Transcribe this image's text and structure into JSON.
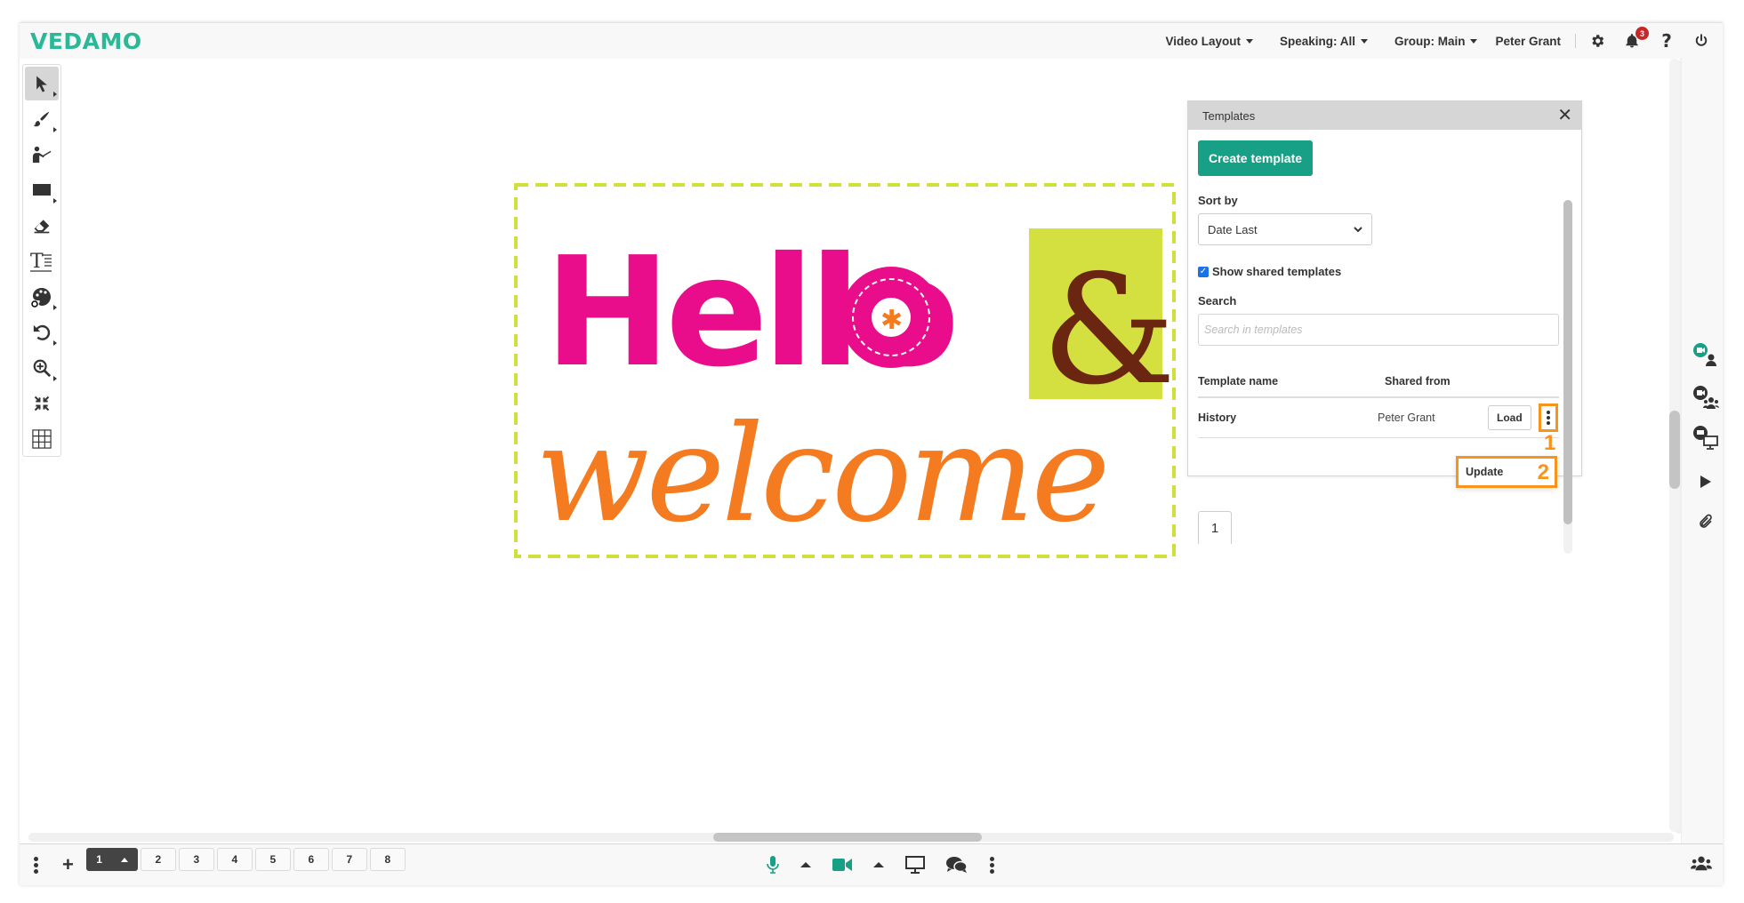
{
  "app": {
    "logo": "VEDAMO",
    "brand_color": "#2bb896",
    "accent_color": "#17a085",
    "annotation_color": "#f7941d"
  },
  "topbar": {
    "menus": [
      {
        "label": "Video Layout",
        "has_caret": true
      },
      {
        "label": "Speaking: All",
        "has_caret": true
      },
      {
        "label": "Group: Main",
        "has_caret": true
      }
    ],
    "user_name": "Peter Grant",
    "icons": [
      "gear-icon",
      "bell-icon",
      "help-icon",
      "power-icon"
    ],
    "notification_count": "3"
  },
  "toolbar": {
    "tools": [
      {
        "name": "select-tool",
        "icon": "cursor-icon",
        "active": true,
        "has_submenu": true
      },
      {
        "name": "brush-tool",
        "icon": "brush-icon",
        "has_submenu": true
      },
      {
        "name": "presenter-tool",
        "icon": "presenter-icon",
        "has_submenu": false
      },
      {
        "name": "shape-tool",
        "icon": "rectangle-icon",
        "has_submenu": true
      },
      {
        "name": "eraser-tool",
        "icon": "eraser-icon",
        "has_submenu": false
      },
      {
        "name": "text-tool",
        "icon": "text-icon",
        "has_submenu": false
      },
      {
        "name": "color-tool",
        "icon": "palette-icon",
        "has_submenu": true
      },
      {
        "name": "undo-tool",
        "icon": "undo-icon",
        "has_submenu": true
      },
      {
        "name": "zoom-tool",
        "icon": "zoom-in-icon",
        "has_submenu": true
      },
      {
        "name": "fit-tool",
        "icon": "compress-icon",
        "has_submenu": false
      },
      {
        "name": "grid-tool",
        "icon": "grid-icon",
        "has_submenu": false
      }
    ]
  },
  "canvas": {
    "image_text_line1": "Hello",
    "image_ampersand": "&",
    "image_text_line2": "welcome"
  },
  "templates_panel": {
    "title": "Templates",
    "create_button": "Create template",
    "sort_label": "Sort by",
    "sort_value": "Date Last",
    "show_shared_label": "Show shared templates",
    "show_shared_checked": true,
    "search_label": "Search",
    "search_placeholder": "Search in templates",
    "columns": [
      "Template name",
      "Shared from"
    ],
    "rows": [
      {
        "name": "History",
        "shared_from": "Peter Grant",
        "load_label": "Load"
      }
    ],
    "menu_item": "Update",
    "annotations": [
      "1",
      "2"
    ],
    "current_page": "1"
  },
  "right_panel": {
    "icons": [
      "video-single-user-icon",
      "video-group-icon",
      "video-screen-share-icon",
      "play-icon",
      "paperclip-icon"
    ]
  },
  "bottombar": {
    "pages": [
      "1",
      "2",
      "3",
      "4",
      "5",
      "6",
      "7",
      "8"
    ],
    "active_page": "1",
    "center_icons": [
      "microphone-icon",
      "caret-up-icon",
      "camera-icon",
      "caret-up-icon",
      "monitor-icon",
      "chat-icon",
      "more-icon"
    ],
    "right_icon": "participants-icon"
  }
}
